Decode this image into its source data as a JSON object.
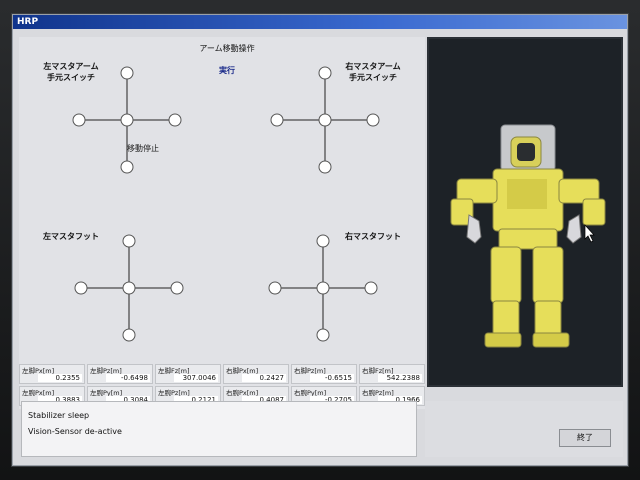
{
  "window": {
    "title": "HRP"
  },
  "header": {
    "title": "アーム移動操作",
    "execute_label": "実行"
  },
  "pads": {
    "left_arm": {
      "label": "左マスタアーム\n手元スイッチ"
    },
    "right_arm": {
      "label": "右マスタアーム\n手元スイッチ"
    },
    "left_foot": {
      "label": "左マスタフット"
    },
    "right_foot": {
      "label": "右マスタフット"
    },
    "stop_label": "移動停止"
  },
  "readouts": {
    "row1": [
      {
        "label": "左脚Px[m]",
        "value": "0.2355"
      },
      {
        "label": "左脚Pz[m]",
        "value": "-0.6498"
      },
      {
        "label": "左脚Fz[m]",
        "value": "307.0046"
      },
      {
        "label": "右脚Px[m]",
        "value": "0.2427"
      },
      {
        "label": "右脚Pz[m]",
        "value": "-0.6515"
      },
      {
        "label": "右脚Fz[m]",
        "value": "542.2388"
      }
    ],
    "row2": [
      {
        "label": "左腕Px[m]",
        "value": "0.3883"
      },
      {
        "label": "左腕Py[m]",
        "value": "0.3084"
      },
      {
        "label": "左腕Pz[m]",
        "value": "0.2121"
      },
      {
        "label": "右腕Px[m]",
        "value": "0.4087"
      },
      {
        "label": "右腕Py[m]",
        "value": "-0.2705"
      },
      {
        "label": "右腕Pz[m]",
        "value": "0.1966"
      }
    ]
  },
  "log": {
    "lines": [
      "Stabilizer sleep",
      "Vision-Sensor de-active"
    ]
  },
  "footer": {
    "end_button_label": "終了"
  },
  "colors": {
    "titlebar": "#1f4fb0",
    "robot_body": "#e6de5a",
    "viewport_bg": "#1d2227"
  }
}
